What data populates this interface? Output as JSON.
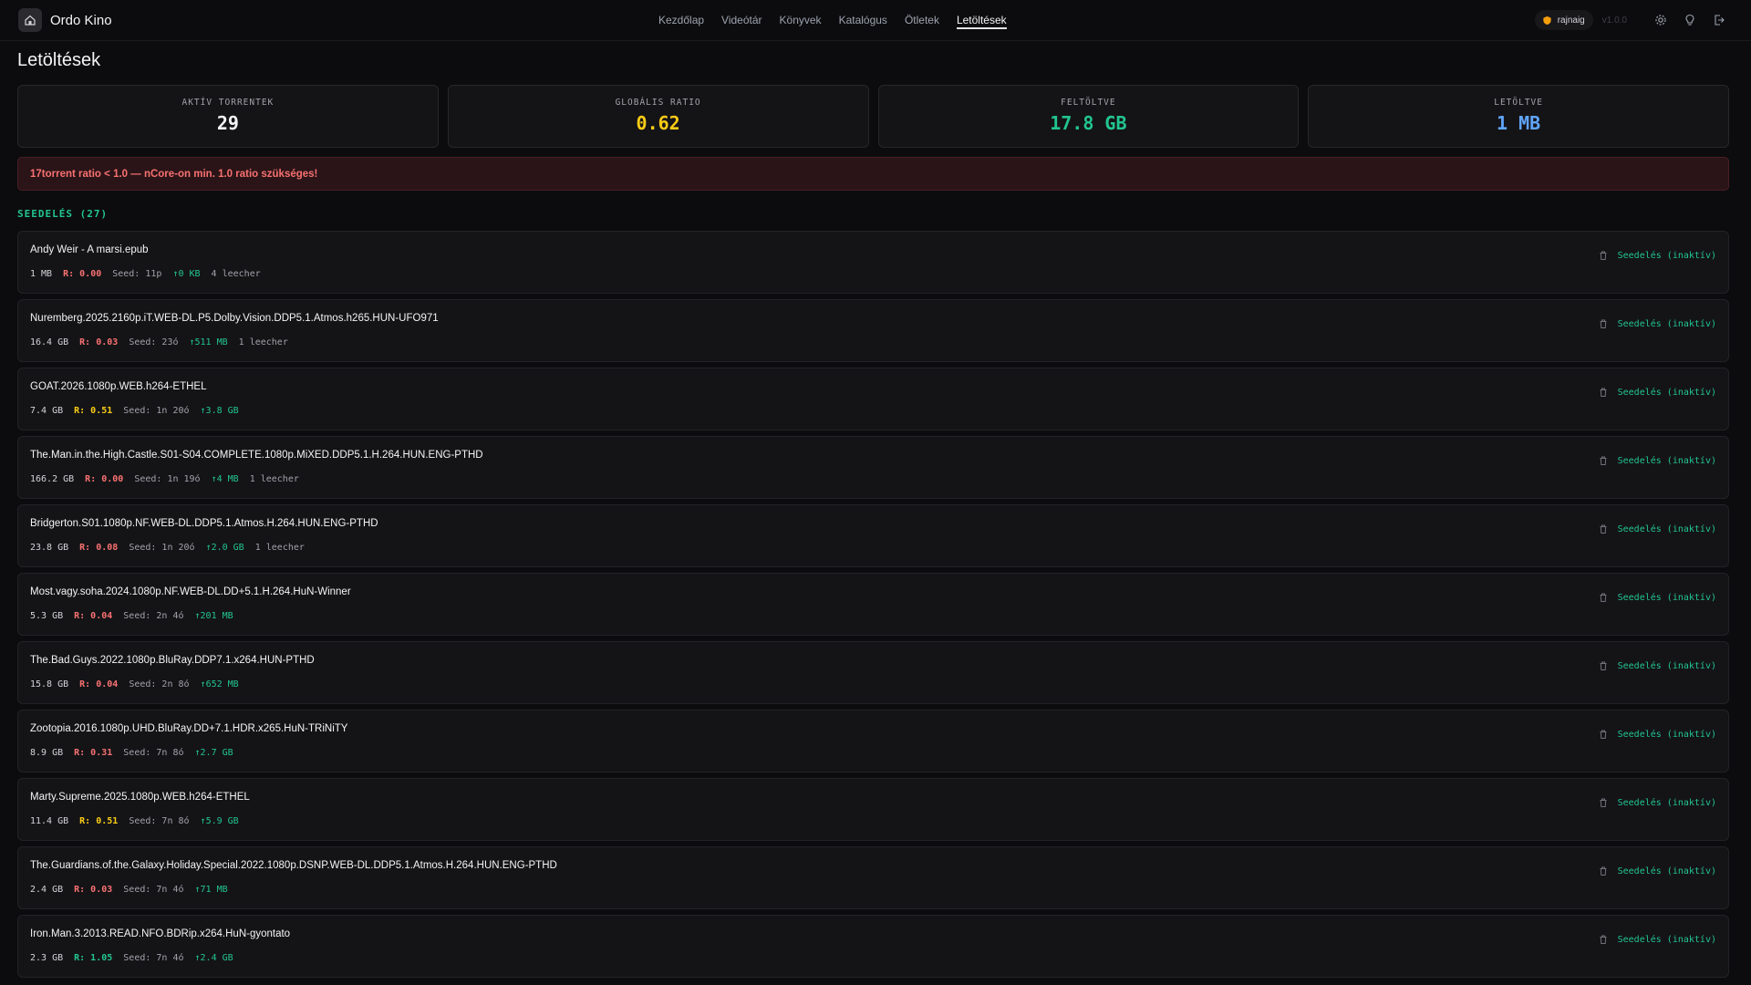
{
  "app": {
    "name": "Ordo Kino",
    "version": "v1.0.0"
  },
  "nav": [
    {
      "label": "Kezdőlap",
      "active": false
    },
    {
      "label": "Videótár",
      "active": false
    },
    {
      "label": "Könyvek",
      "active": false
    },
    {
      "label": "Katalógus",
      "active": false
    },
    {
      "label": "Ötletek",
      "active": false
    },
    {
      "label": "Letöltések",
      "active": true
    }
  ],
  "user": {
    "name": "rajnaig"
  },
  "page": {
    "title": "Letöltések"
  },
  "stats": [
    {
      "label": "AKTÍV TORRENTEK",
      "value": "29",
      "color": "#f4f4f5"
    },
    {
      "label": "GLOBÁLIS RATIO",
      "value": "0.62",
      "color": "#facc15"
    },
    {
      "label": "FELTÖLTVE",
      "value": "17.8 GB",
      "color": "#22c58e"
    },
    {
      "label": "LETÖLTVE",
      "value": "1 MB",
      "color": "#60a5fa"
    }
  ],
  "warning": "17torrent ratio < 1.0 — nCore-on min. 1.0 ratio szükséges!",
  "section": {
    "title": "SEEDELÉS (27)"
  },
  "colors": {
    "ratio_bad": "#f87171",
    "ratio_mid": "#facc15",
    "ratio_good": "#22c58e"
  },
  "torrents": [
    {
      "name": "Andy Weir - A marsi.epub",
      "size": "1 MB",
      "ratio": "R: 0.00",
      "ratio_level": "bad",
      "seed": "Seed: 11p",
      "up": "↑0 KB",
      "leech": "4 leecher",
      "status": "Seedelés (inaktív)"
    },
    {
      "name": "Nuremberg.2025.2160p.iT.WEB-DL.P5.Dolby.Vision.DDP5.1.Atmos.h265.HUN-UFO971",
      "size": "16.4 GB",
      "ratio": "R: 0.03",
      "ratio_level": "bad",
      "seed": "Seed: 23ó",
      "up": "↑511 MB",
      "leech": "1 leecher",
      "status": "Seedelés (inaktív)"
    },
    {
      "name": "GOAT.2026.1080p.WEB.h264-ETHEL",
      "size": "7.4 GB",
      "ratio": "R: 0.51",
      "ratio_level": "mid",
      "seed": "Seed: 1n 20ó",
      "up": "↑3.8 GB",
      "leech": "",
      "status": "Seedelés (inaktív)"
    },
    {
      "name": "The.Man.in.the.High.Castle.S01-S04.COMPLETE.1080p.MiXED.DDP5.1.H.264.HUN.ENG-PTHD",
      "size": "166.2 GB",
      "ratio": "R: 0.00",
      "ratio_level": "bad",
      "seed": "Seed: 1n 19ó",
      "up": "↑4 MB",
      "leech": "1 leecher",
      "status": "Seedelés (inaktív)"
    },
    {
      "name": "Bridgerton.S01.1080p.NF.WEB-DL.DDP5.1.Atmos.H.264.HUN.ENG-PTHD",
      "size": "23.8 GB",
      "ratio": "R: 0.08",
      "ratio_level": "bad",
      "seed": "Seed: 1n 20ó",
      "up": "↑2.0 GB",
      "leech": "1 leecher",
      "status": "Seedelés (inaktív)"
    },
    {
      "name": "Most.vagy.soha.2024.1080p.NF.WEB-DL.DD+5.1.H.264.HuN-Winner",
      "size": "5.3 GB",
      "ratio": "R: 0.04",
      "ratio_level": "bad",
      "seed": "Seed: 2n 4ó",
      "up": "↑201 MB",
      "leech": "",
      "status": "Seedelés (inaktív)"
    },
    {
      "name": "The.Bad.Guys.2022.1080p.BluRay.DDP7.1.x264.HUN-PTHD",
      "size": "15.8 GB",
      "ratio": "R: 0.04",
      "ratio_level": "bad",
      "seed": "Seed: 2n 8ó",
      "up": "↑652 MB",
      "leech": "",
      "status": "Seedelés (inaktív)"
    },
    {
      "name": "Zootopia.2016.1080p.UHD.BluRay.DD+7.1.HDR.x265.HuN-TRiNiTY",
      "size": "8.9 GB",
      "ratio": "R: 0.31",
      "ratio_level": "bad",
      "seed": "Seed: 7n 8ó",
      "up": "↑2.7 GB",
      "leech": "",
      "status": "Seedelés (inaktív)"
    },
    {
      "name": "Marty.Supreme.2025.1080p.WEB.h264-ETHEL",
      "size": "11.4 GB",
      "ratio": "R: 0.51",
      "ratio_level": "mid",
      "seed": "Seed: 7n 8ó",
      "up": "↑5.9 GB",
      "leech": "",
      "status": "Seedelés (inaktív)"
    },
    {
      "name": "The.Guardians.of.the.Galaxy.Holiday.Special.2022.1080p.DSNP.WEB-DL.DDP5.1.Atmos.H.264.HUN.ENG-PTHD",
      "size": "2.4 GB",
      "ratio": "R: 0.03",
      "ratio_level": "bad",
      "seed": "Seed: 7n 4ó",
      "up": "↑71 MB",
      "leech": "",
      "status": "Seedelés (inaktív)"
    },
    {
      "name": "Iron.Man.3.2013.READ.NFO.BDRip.x264.HuN-gyontato",
      "size": "2.3 GB",
      "ratio": "R: 1.05",
      "ratio_level": "good",
      "seed": "Seed: 7n 4ó",
      "up": "↑2.4 GB",
      "leech": "",
      "status": "Seedelés (inaktív)"
    }
  ]
}
